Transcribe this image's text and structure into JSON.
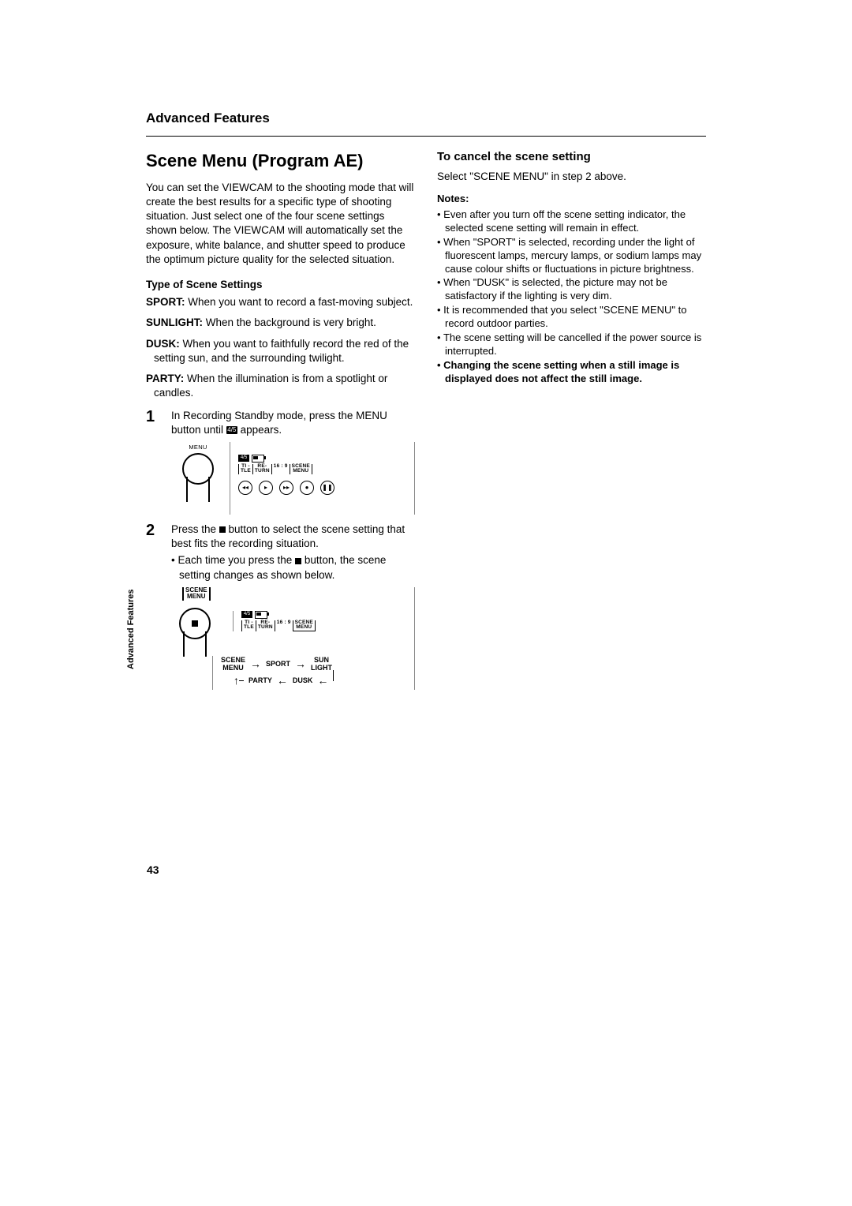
{
  "header": {
    "section": "Advanced Features"
  },
  "title": "Scene Menu (Program AE)",
  "intro": "You can set the VIEWCAM to the shooting mode that will create the best results for a specific type of shooting situation. Just select one of the four scene settings shown below. The VIEWCAM will automatically set the exposure, white balance, and shutter speed to produce the optimum picture quality for the selected situation.",
  "type_heading": "Type of Scene Settings",
  "scenes": {
    "sport": {
      "label": "SPORT:",
      "text": " When you want to record a fast-moving subject."
    },
    "sunlight": {
      "label": "SUNLIGHT:",
      "text": " When the background is very bright."
    },
    "dusk": {
      "label": "DUSK:",
      "text": " When you want to faithfully record the red of the setting sun, and the surrounding twilight."
    },
    "party": {
      "label": "PARTY:",
      "text": " When the illumination is from a spotlight or candles."
    }
  },
  "steps": {
    "s1": {
      "num": "1",
      "text_a": "In Recording Standby mode, press the MENU button until ",
      "text_b": " appears.",
      "icon": "4/5"
    },
    "s2": {
      "num": "2",
      "text_a": "Press the ",
      "text_b": " button to select the scene setting that best fits the recording situation.",
      "bullet_a": "• Each time you press the ",
      "bullet_b": " button, the scene setting changes as shown below."
    }
  },
  "fig1": {
    "menu_label": "MENU",
    "badge": "4/5",
    "tile": "TI -\nTLE",
    "return": "RE-\nTURN",
    "r169": "16 : 9",
    "scene": "SCENE\nMENU",
    "transport": [
      "◂◂",
      "▸",
      "▸▸",
      "●",
      "❚❚"
    ]
  },
  "fig2": {
    "scene_label": "SCENE\nMENU",
    "badge": "4/5",
    "tile": "TI -\nTLE",
    "return": "RE-\nTURN",
    "r169": "16 : 9",
    "scene": "SCENE\nMENU",
    "cycle": {
      "a": "SCENE\nMENU",
      "b": "SPORT",
      "c": "SUN\nLIGHT",
      "d": "PARTY",
      "e": "DUSK"
    }
  },
  "right": {
    "cancel_head": "To cancel the scene setting",
    "cancel_body": "Select \"SCENE MENU\" in step 2 above.",
    "notes_label": "Notes:",
    "notes": [
      "Even after you turn off the scene setting indicator, the selected scene setting will remain in effect.",
      "When \"SPORT\" is selected, recording under the light of fluorescent lamps, mercury lamps, or sodium lamps may cause colour shifts or fluctuations in picture brightness.",
      "When \"DUSK\" is selected, the picture may not be satisfactory if the lighting is very dim.",
      "It is recommended that you select \"SCENE MENU\" to record outdoor parties.",
      "The scene setting will be cancelled if the power source is interrupted."
    ],
    "note_bold": "Changing the scene setting when a still image is displayed does not affect the still image."
  },
  "side_tab": "Advanced Features",
  "page_number": "43"
}
